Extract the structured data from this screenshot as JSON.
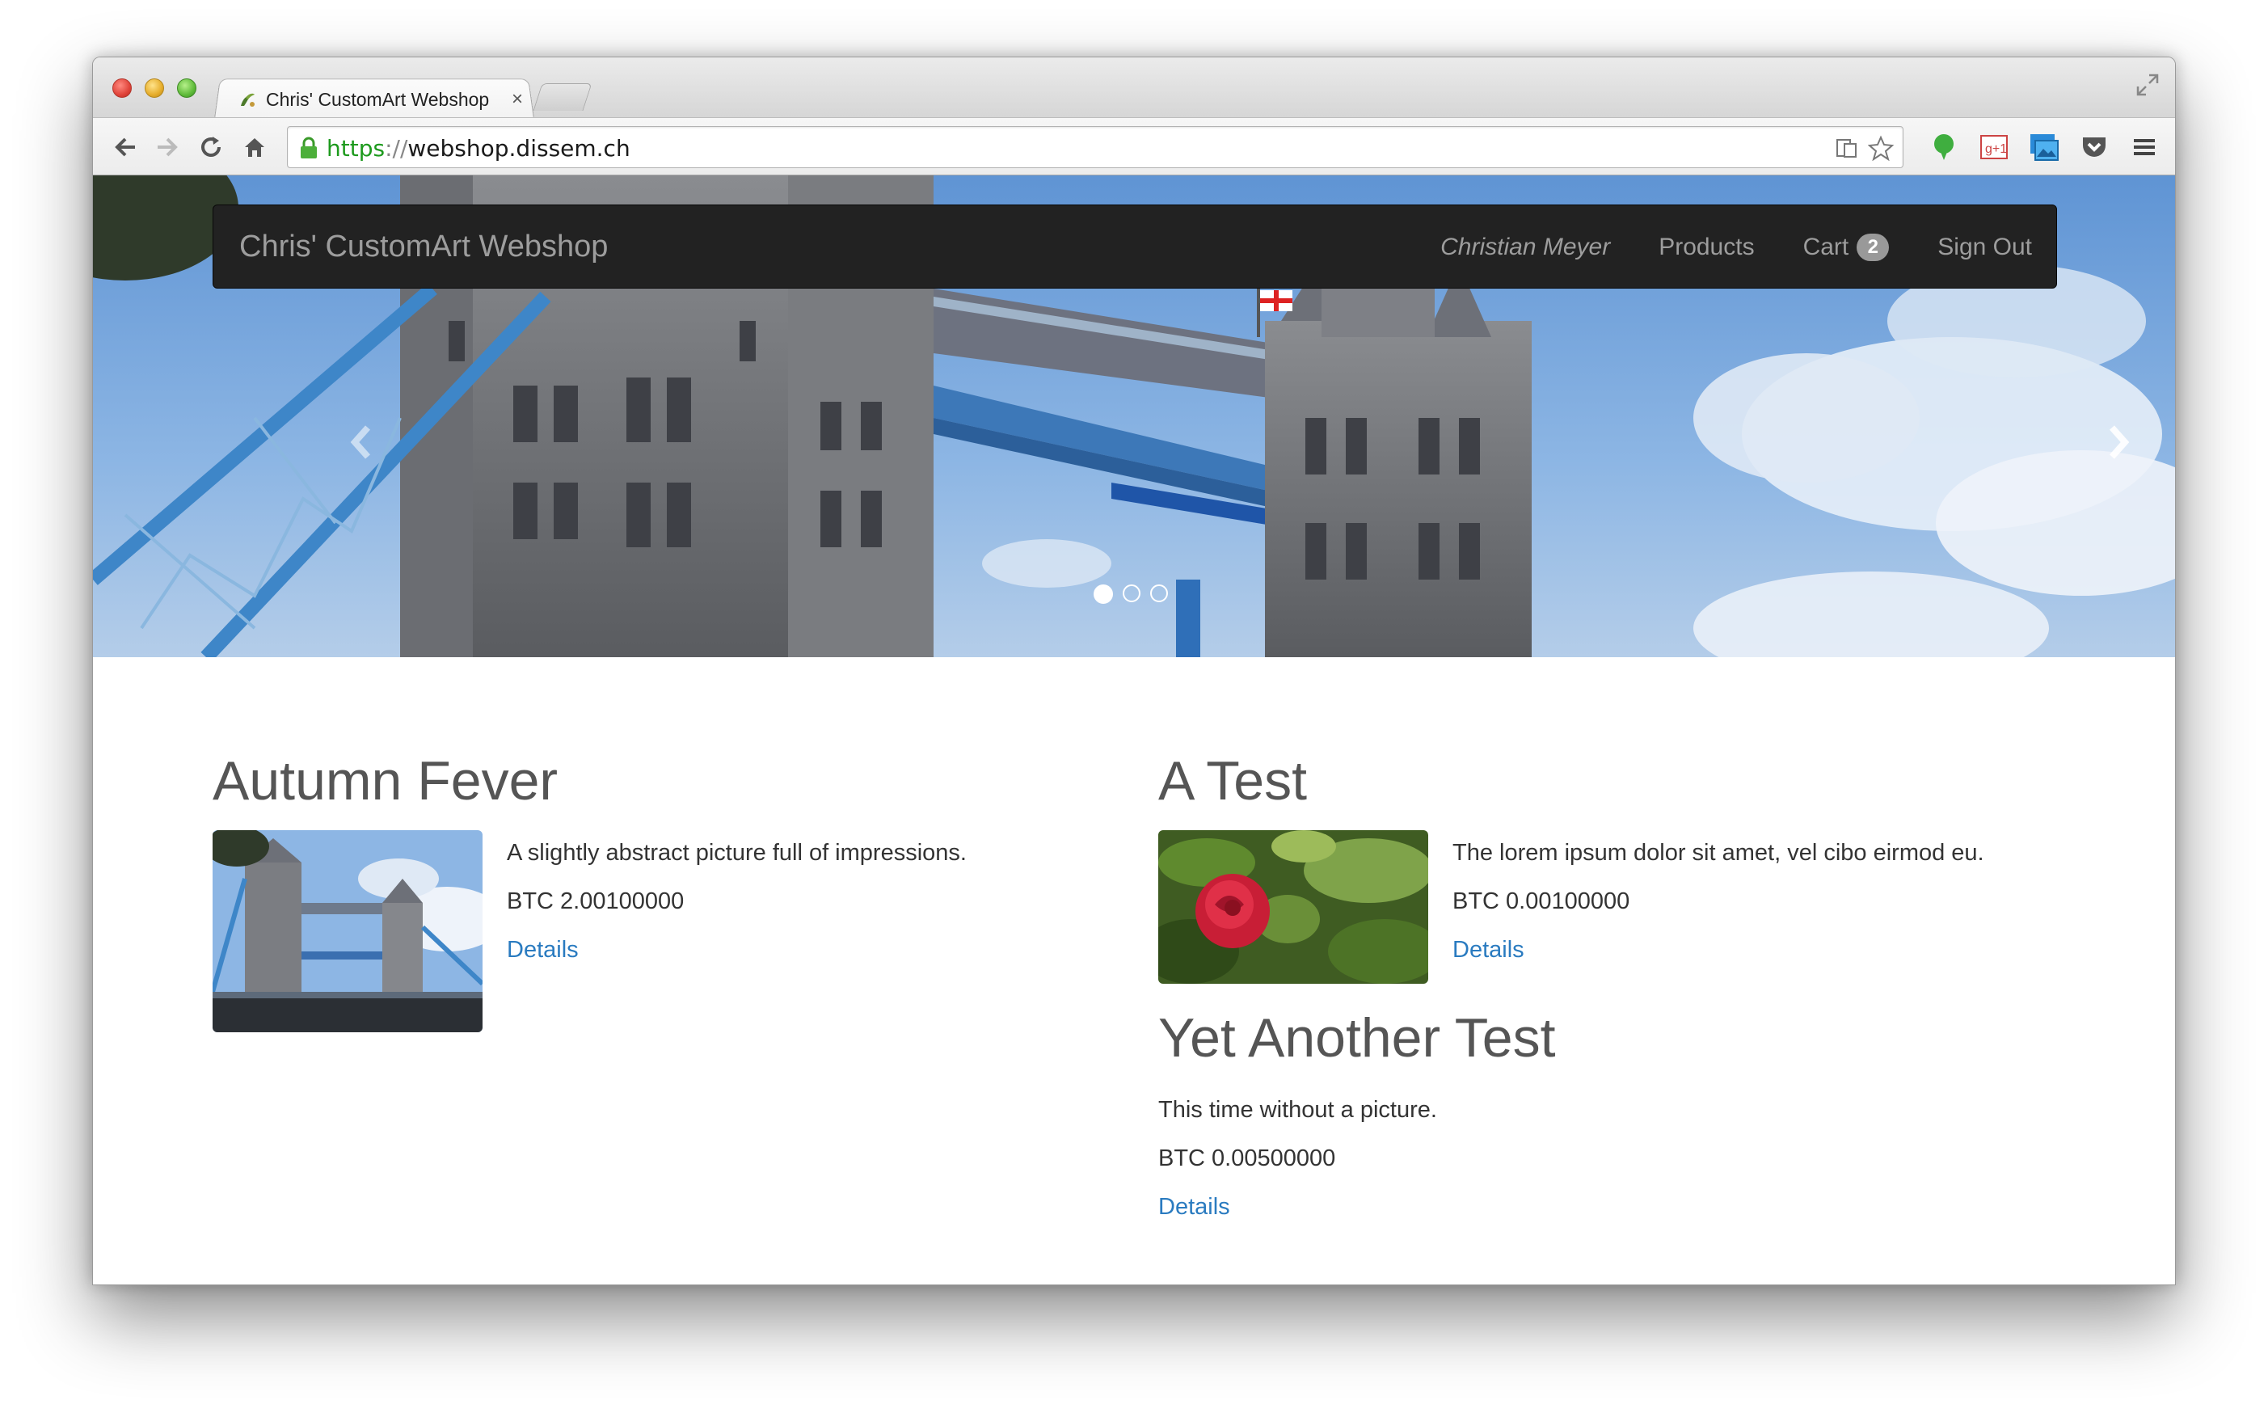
{
  "browser": {
    "tab_title": "Chris' CustomArt Webshop",
    "tab_close": "×",
    "url_scheme": "https",
    "url_sep": "://",
    "url_host": "webshop.dissem.ch"
  },
  "navbar": {
    "brand": "Chris' CustomArt Webshop",
    "user": "Christian Meyer",
    "products": "Products",
    "cart": "Cart",
    "cart_count": "2",
    "sign_out": "Sign Out"
  },
  "carousel": {
    "slide_count": 3,
    "active_index": 0
  },
  "products": [
    {
      "title": "Autumn Fever",
      "description": "A slightly abstract picture full of impressions.",
      "price": "BTC 2.00100000",
      "link": "Details",
      "has_image": true,
      "image": "tower-bridge"
    },
    {
      "title": "A Test",
      "description": "The lorem ipsum dolor sit amet, vel cibo eirmod eu.",
      "price": "BTC 0.00100000",
      "link": "Details",
      "has_image": true,
      "image": "red-rose"
    },
    {
      "title": "Yet Another Test",
      "description": "This time without a picture.",
      "price": "BTC 0.00500000",
      "link": "Details",
      "has_image": false
    }
  ],
  "colors": {
    "navbar_bg": "#222222",
    "navbar_text": "#9d9d9d",
    "link": "#2a7bc0",
    "heading": "#555555",
    "badge": "#999999"
  },
  "icons": [
    "back-icon",
    "forward-icon",
    "reload-icon",
    "home-icon",
    "lock-icon",
    "page-action-icon",
    "star-icon",
    "evernote-icon",
    "google-plus-icon",
    "image-extension-icon",
    "pocket-icon",
    "menu-icon",
    "fullscreen-icon",
    "chevron-left-icon",
    "chevron-right-icon"
  ]
}
